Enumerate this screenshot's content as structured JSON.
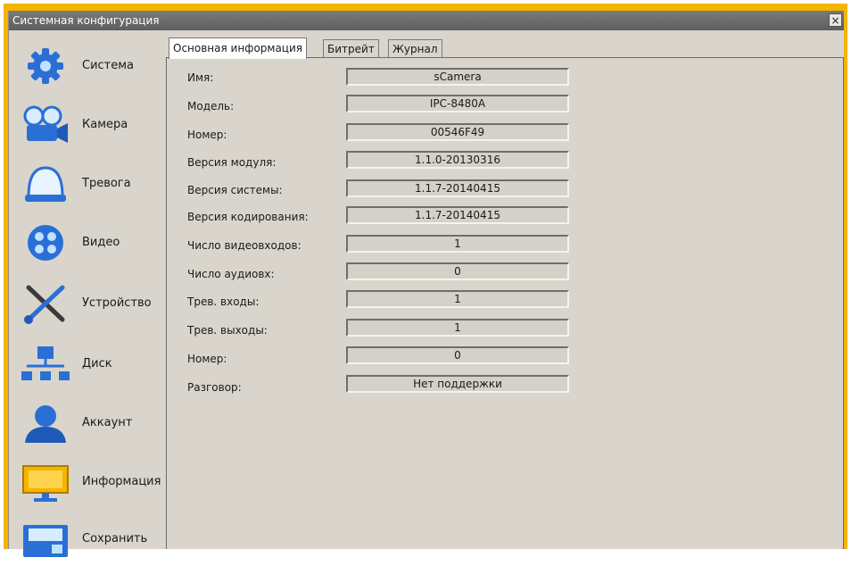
{
  "window": {
    "title": "Системная конфигурация",
    "close_glyph": "×"
  },
  "sidebar": {
    "items": [
      {
        "label": "Система",
        "icon": "gear-icon"
      },
      {
        "label": "Камера",
        "icon": "camera-icon"
      },
      {
        "label": "Тревога",
        "icon": "alarm-icon"
      },
      {
        "label": "Видео",
        "icon": "video-icon"
      },
      {
        "label": "Устройство",
        "icon": "tools-icon"
      },
      {
        "label": "Диск",
        "icon": "disk-network-icon"
      },
      {
        "label": "Аккаунт",
        "icon": "user-icon"
      },
      {
        "label": "Информация",
        "icon": "info-icon"
      },
      {
        "label": "Сохранить",
        "icon": "save-icon"
      }
    ]
  },
  "tabs": [
    {
      "label": "Основная информация",
      "active": true
    },
    {
      "label": "Битрейт",
      "active": false
    },
    {
      "label": "Журнал",
      "active": false
    }
  ],
  "info": {
    "rows": [
      {
        "label": "Имя:",
        "value": "sCamera"
      },
      {
        "label": "Модель:",
        "value": "IPC-8480A"
      },
      {
        "label": "Номер:",
        "value": "00546F49"
      },
      {
        "label": "Версия модуля:",
        "value": "1.1.0-20130316"
      },
      {
        "label": "Версия системы:",
        "value": "1.1.7-20140415"
      },
      {
        "label": "Версия кодирования:",
        "value": "1.1.7-20140415"
      },
      {
        "label": "Число видеовходов:",
        "value": "1"
      },
      {
        "label": "Число аудиовх:",
        "value": "0"
      },
      {
        "label": "Трев. входы:",
        "value": "1"
      },
      {
        "label": "Трев. выходы:",
        "value": "1"
      },
      {
        "label": "Номер:",
        "value": "0"
      },
      {
        "label": "Разговор:",
        "value": "Нет поддержки"
      }
    ]
  }
}
